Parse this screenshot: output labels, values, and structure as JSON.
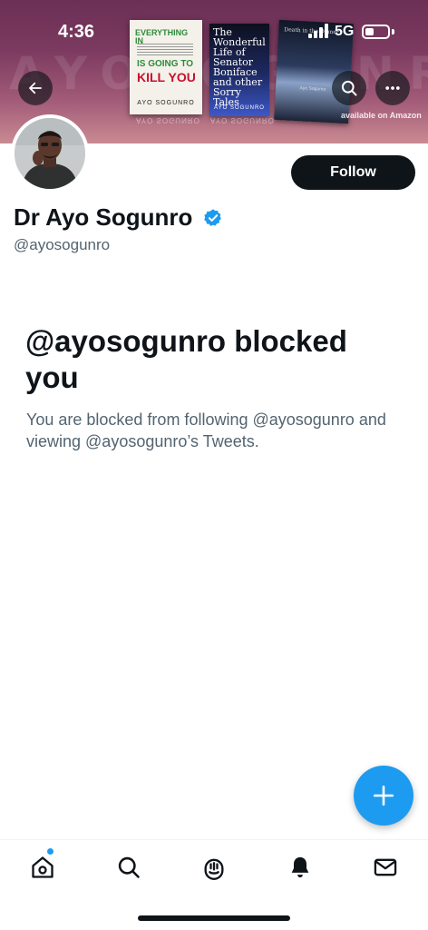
{
  "status_bar": {
    "time": "4:36",
    "network": "5G"
  },
  "banner": {
    "watermark": "AYOSOGUNRO",
    "books": [
      {
        "title_top": "EVERYTHING IN",
        "title_mid": "IS GOING TO",
        "title_kill": "KILL YOU",
        "author": "AYO SOGUNRO"
      },
      {
        "title": "The Wonderful Life of Senator Boniface and other Sorry Tales",
        "author": "AYO SOGUNRO"
      },
      {
        "title": "Death in the Dinner",
        "author": "Ayo Sogunro"
      }
    ],
    "note": "available on Amazon"
  },
  "profile": {
    "follow_label": "Follow",
    "display_name": "Dr Ayo Sogunro",
    "handle": "@ayosogunro",
    "verified": true
  },
  "blocked": {
    "title": "@ayosogunro blocked you",
    "body": "You are blocked from following @ayosogunro and viewing @ayosogunro’s Tweets."
  },
  "colors": {
    "accent": "#1d9bf0",
    "text": "#0f1419",
    "secondary_text": "#536471"
  },
  "icons": {
    "back": "arrow-left-icon",
    "search": "search-icon",
    "more": "more-horizontal-icon",
    "compose": "plus-icon",
    "home": "home-icon",
    "explore": "search-icon",
    "spaces": "spaces-icon",
    "notifications": "bell-icon",
    "messages": "envelope-icon"
  }
}
